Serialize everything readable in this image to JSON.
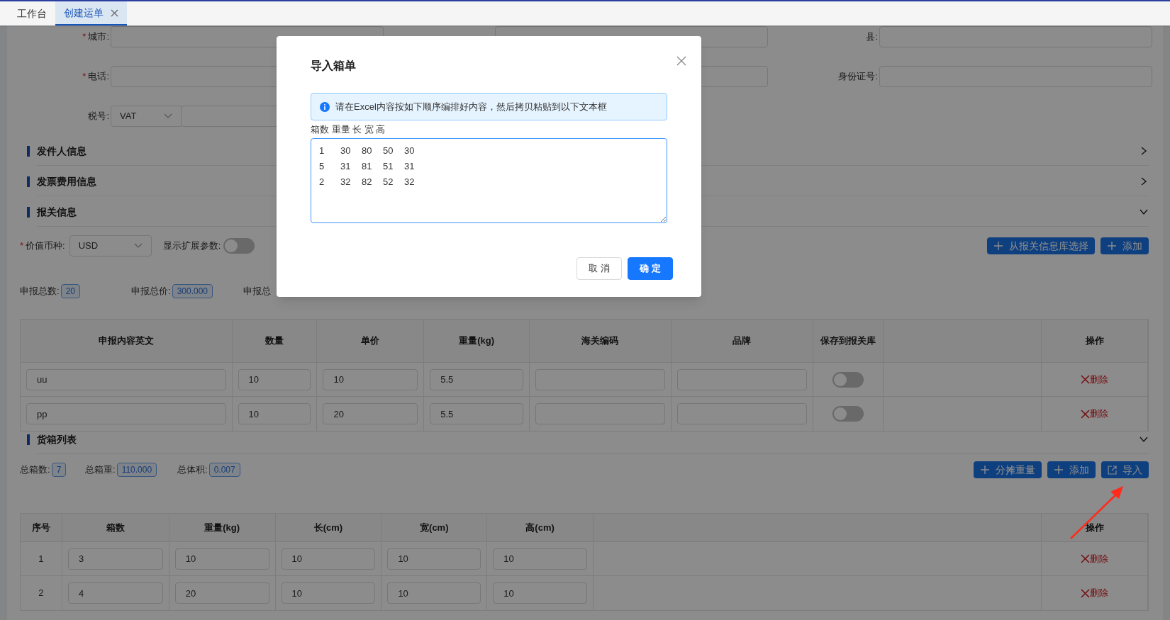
{
  "tabs": [
    {
      "label": "工作台",
      "selected": false,
      "closable": false
    },
    {
      "label": "创建运单",
      "selected": true,
      "closable": true
    }
  ],
  "form_rows": [
    [
      {
        "required_mark": "*",
        "label": "城市:",
        "kind": "input"
      },
      {
        "kind": "input"
      },
      {
        "label": "县:",
        "kind": "input"
      }
    ],
    [
      {
        "required_mark": "*",
        "label": "电话:",
        "kind": "input"
      },
      {
        "kind": "input"
      },
      {
        "label": "身份证号:",
        "kind": "input"
      }
    ],
    [
      {
        "label": "税号:",
        "kind": "select_input",
        "value": "VAT"
      }
    ]
  ],
  "sections": [
    {
      "title": "发件人信息",
      "expanded": false
    },
    {
      "title": "发票费用信息",
      "expanded": false
    },
    {
      "title": "报关信息",
      "expanded": true
    }
  ],
  "customs": {
    "currency": {
      "required_mark": "*",
      "label": "价值币种:",
      "value": "USD"
    },
    "ext_toggle": {
      "label": "显示扩展参数:",
      "on": false
    },
    "buttons": [
      {
        "label": "从报关信息库选择",
        "kind": "add"
      },
      {
        "label": "添加",
        "kind": "add"
      }
    ],
    "totals": [
      {
        "label": "申报总数:",
        "value": "20"
      },
      {
        "label": "申报总价:",
        "value": "300.000"
      },
      {
        "label": "申报总"
      }
    ],
    "table": {
      "columns": [
        "申报内容英文",
        "数量",
        "单价",
        "重量(kg)",
        "海关编码",
        "品牌",
        "保存到报关库",
        "操作"
      ],
      "rows": [
        {
          "cells": [
            "uu",
            "10",
            "10",
            "5.5"
          ],
          "save_to_library": false,
          "delete": "删除"
        },
        {
          "cells": [
            "pp",
            "10",
            "20",
            "5.5"
          ],
          "save_to_library": false,
          "delete": "删除"
        }
      ]
    }
  },
  "cargo": {
    "title": "货箱列表",
    "expanded": true,
    "totals": [
      {
        "label": "总箱数:",
        "value": "7"
      },
      {
        "label": "总箱重:",
        "value": "110.000"
      },
      {
        "label": "总体积:",
        "value": "0.007"
      }
    ],
    "buttons": [
      {
        "label": "分摊重量",
        "kind": "add"
      },
      {
        "label": "添加",
        "kind": "add"
      },
      {
        "label": "导入",
        "kind": "import"
      }
    ],
    "table": {
      "columns": [
        "序号",
        "箱数",
        "重量(kg)",
        "长(cm)",
        "宽(cm)",
        "高(cm)",
        "操作"
      ],
      "rows": [
        {
          "index": "1",
          "cells": [
            "3",
            "10",
            "10",
            "10",
            "10"
          ],
          "delete": "删除"
        },
        {
          "index": "2",
          "cells": [
            "4",
            "20",
            "10",
            "10",
            "10"
          ],
          "delete": "删除"
        }
      ]
    }
  },
  "modal": {
    "title": "导入箱单",
    "alert": "请在Excel内容按如下顺序编排好内容，然后拷贝粘贴到以下文本框",
    "format_label": "箱数 重量 长 宽 高",
    "textarea": "1\t30\t80\t50\t30\n5\t31\t81\t51\t31\n2\t32\t82\t52\t32\n",
    "buttons": [
      {
        "label": "取 消",
        "kind": "default"
      },
      {
        "label": "确 定",
        "kind": "primary"
      }
    ]
  }
}
